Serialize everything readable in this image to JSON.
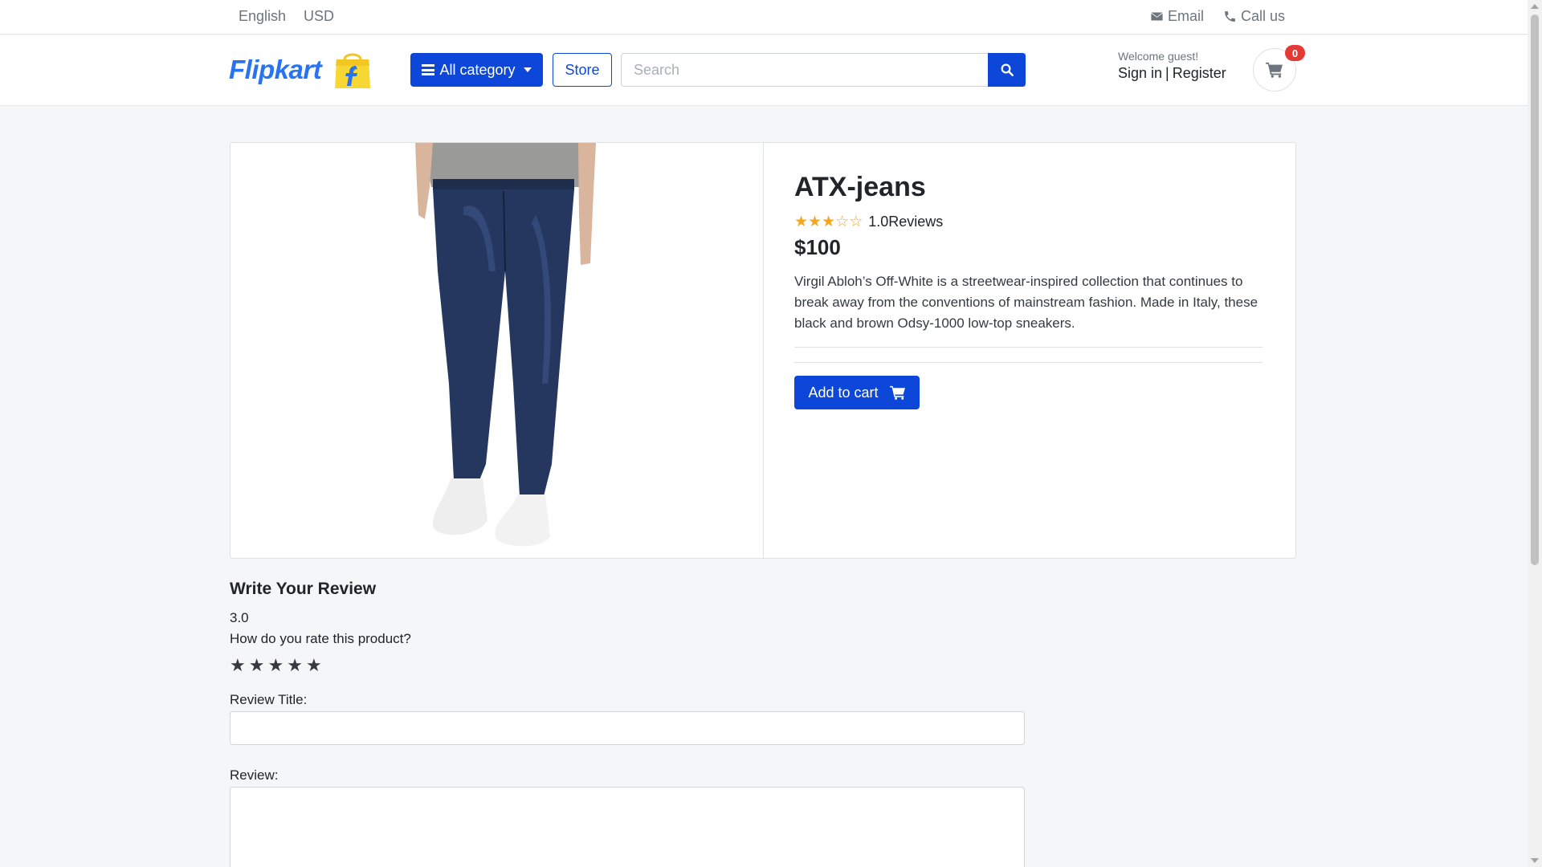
{
  "topbar": {
    "language": "English",
    "currency": "USD",
    "email_label": "Email",
    "call_label": "Call us"
  },
  "header": {
    "logo_text": "Flipkart",
    "category_button": "All category",
    "store_button": "Store",
    "search_placeholder": "Search",
    "welcome": "Welcome guest!",
    "sign_in": "Sign in",
    "separator": "|",
    "register": "Register",
    "cart_count": "0"
  },
  "product": {
    "title": "ATX-jeans",
    "rating_value": 3,
    "rating_max": 5,
    "reviews_label": "1.0Reviews",
    "price": "$100",
    "description": "Virgil Abloh’s Off-White is a streetwear-inspired collection that continues to break away from the conventions of mainstream fashion. Made in Italy, these black and brown Odsy-1000 low-top sneakers.",
    "add_to_cart": "Add to cart"
  },
  "review_form": {
    "heading": "Write Your Review",
    "rating_value": "3.0",
    "question": "How do you rate this product?",
    "title_label": "Review Title:",
    "title_value": "",
    "review_label": "Review:",
    "review_value": ""
  },
  "colors": {
    "primary": "#0d47d9",
    "logo_blue": "#2874f0",
    "star": "#f5a623",
    "badge": "#e53935"
  },
  "icons": [
    "envelope-icon",
    "phone-icon",
    "bars-icon",
    "caret-down-icon",
    "search-icon",
    "shopping-cart-icon",
    "star-icon"
  ]
}
